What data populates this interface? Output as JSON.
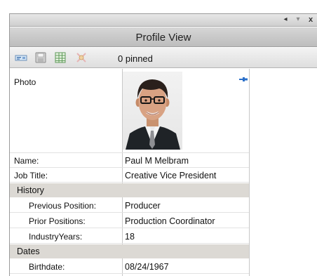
{
  "window": {
    "buttons": {
      "scroll_left": "◂",
      "dropdown": "▾",
      "close": "x"
    }
  },
  "header": {
    "title": "Profile View"
  },
  "toolbar": {
    "icons": [
      "card-icon",
      "save-icon",
      "grid-icon",
      "clear-pins-icon"
    ],
    "pinned_count": "0 pinned"
  },
  "profile": {
    "photo_label": "Photo",
    "name_label": "Name:",
    "name_value": "Paul M Melbram",
    "jobtitle_label": "Job Title:",
    "jobtitle_value": "Creative Vice President",
    "history": {
      "label": "History",
      "previous_position_label": "Previous Position:",
      "previous_position_value": "Producer",
      "prior_positions_label": "Prior Positions:",
      "prior_positions_value": "Production Coordinator",
      "industry_years_label": "IndustryYears:",
      "industry_years_value": "18"
    },
    "dates": {
      "label": "Dates",
      "birthdate_label": "Birthdate:",
      "birthdate_value": "08/24/1967"
    }
  },
  "colors": {
    "category_bg": "#dcd9d4",
    "pin_blue": "#2a6fc9"
  }
}
